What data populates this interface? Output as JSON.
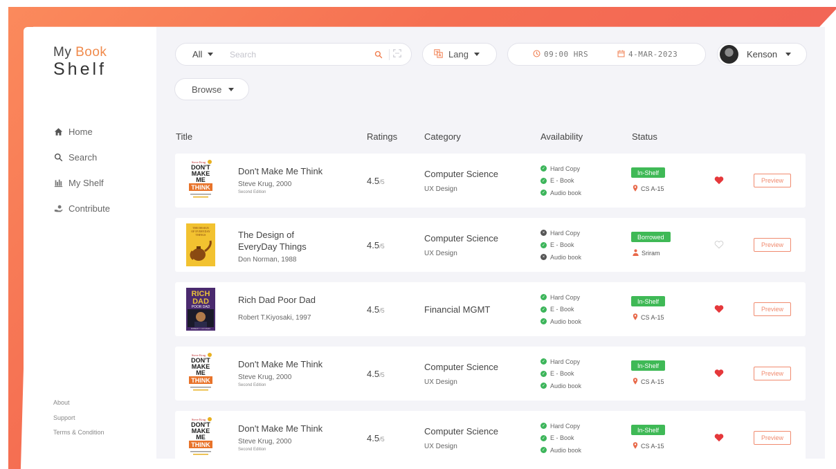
{
  "app": {
    "logo_line1_a": "My",
    "logo_line1_b": "Book",
    "logo_line2": "Shelf"
  },
  "sidebar": {
    "items": [
      {
        "label": "Home",
        "icon": "home-icon"
      },
      {
        "label": "Search",
        "icon": "search-icon"
      },
      {
        "label": "My Shelf",
        "icon": "shelf-icon"
      },
      {
        "label": "Contribute",
        "icon": "contribute-icon"
      }
    ],
    "footer": [
      "About",
      "Support",
      "Terms & Condition"
    ]
  },
  "topbar": {
    "filter_value": "All",
    "search_placeholder": "Search",
    "lang_label": "Lang",
    "time": "09:00 HRS",
    "date": "4-MAR-2023",
    "user_name": "Kenson",
    "browse_label": "Browse"
  },
  "table": {
    "headers": [
      "Title",
      "Ratings",
      "Category",
      "Availability",
      "Status"
    ],
    "rating_suffix": "/5",
    "preview_label": "Preview",
    "rows": [
      {
        "title_l1": "Don't Make Me Think",
        "title_l2": "",
        "author": "Steve Krug, 2000",
        "edition": "Second Edition",
        "rating": "4.5",
        "category": "Computer Science",
        "subcategory": "UX Design",
        "availability": [
          [
            "Hard Copy",
            "ok"
          ],
          [
            "E - Book",
            "ok"
          ],
          [
            "Audio book",
            "ok"
          ]
        ],
        "status": "In-Shelf",
        "location": "CS A-15",
        "favorite": true
      },
      {
        "title_l1": "The Design of",
        "title_l2": "EveryDay Things",
        "author": "Don Norman, 1988",
        "edition": "",
        "rating": "4.5",
        "category": "Computer Science",
        "subcategory": "UX Design",
        "availability": [
          [
            "Hard Copy",
            "no"
          ],
          [
            "E - Book",
            "ok"
          ],
          [
            "Audio book",
            "no"
          ]
        ],
        "status": "Borrowed",
        "location": "Sriram",
        "favorite": false
      },
      {
        "title_l1": "Rich Dad Poor Dad",
        "title_l2": "",
        "author": "Robert T.Kiyosaki, 1997",
        "edition": "",
        "rating": "4.5",
        "category": "Financial MGMT",
        "subcategory": "",
        "availability": [
          [
            "Hard Copy",
            "ok"
          ],
          [
            "E - Book",
            "ok"
          ],
          [
            "Audio book",
            "ok"
          ]
        ],
        "status": "In-Shelf",
        "location": "CS A-15",
        "favorite": true
      },
      {
        "title_l1": "Don't Make Me Think",
        "title_l2": "",
        "author": "Steve Krug, 2000",
        "edition": "Second Edition",
        "rating": "4.5",
        "category": "Computer Science",
        "subcategory": "UX Design",
        "availability": [
          [
            "Hard Copy",
            "ok"
          ],
          [
            "E - Book",
            "ok"
          ],
          [
            "Audio book",
            "ok"
          ]
        ],
        "status": "In-Shelf",
        "location": "CS A-15",
        "favorite": true
      },
      {
        "title_l1": "Don't Make Me Think",
        "title_l2": "",
        "author": "Steve Krug, 2000",
        "edition": "Second Edition",
        "rating": "4.5",
        "category": "Computer Science",
        "subcategory": "UX Design",
        "availability": [
          [
            "Hard Copy",
            "ok"
          ],
          [
            "E - Book",
            "ok"
          ],
          [
            "Audio book",
            "ok"
          ]
        ],
        "status": "In-Shelf",
        "location": "CS A-15",
        "favorite": true
      }
    ]
  },
  "cover_art": {
    "dmmt": {
      "top": "Steve Krug",
      "l1": "DON'T",
      "l2": "MAKE",
      "l3": "ME",
      "l4": "THINK"
    },
    "doet": {
      "l1": "THE DESIGN",
      "l2": "OF EVERYDAY",
      "l3": "THINGS"
    },
    "rdpd": {
      "l1": "RICH",
      "l2": "DAD",
      "l3": "POOR DAD",
      "l4": "ROBERT T. KIYOSAKI"
    }
  },
  "colors": {
    "accent": "#f07a4a",
    "green": "#3fb956",
    "heart": "#e5383b",
    "borrowed_icon": "#e8694a"
  }
}
